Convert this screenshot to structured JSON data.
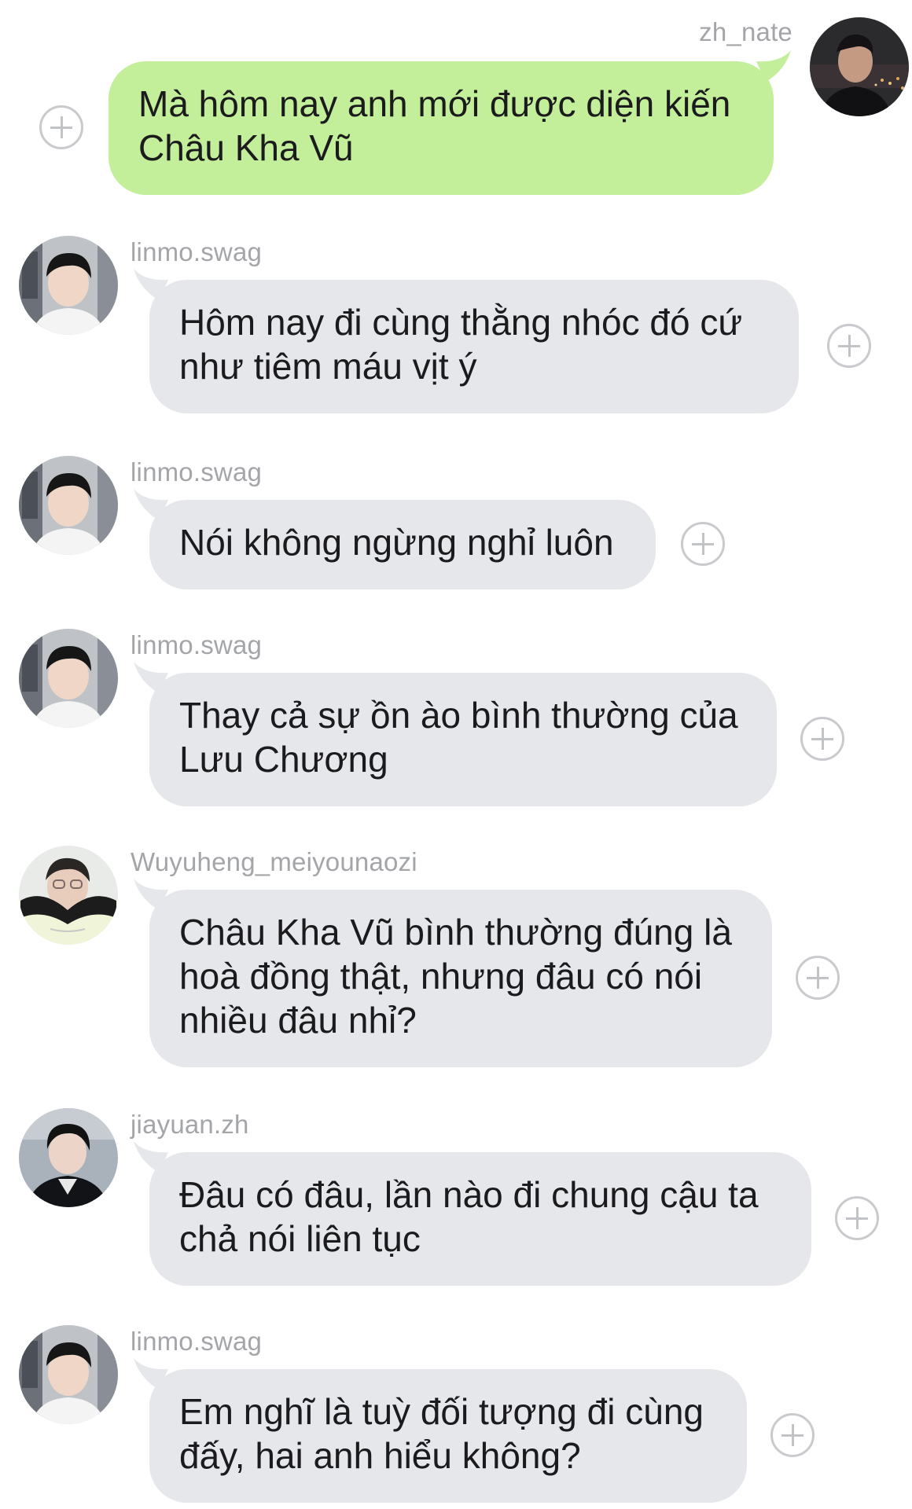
{
  "messages": [
    {
      "username": "zh_nate",
      "direction": "outgoing",
      "avatar": "zh-nate-avatar",
      "lines": [
        "Mà hôm nay anh mới được diện kiến",
        "Châu Kha Vũ"
      ]
    },
    {
      "username": "linmo.swag",
      "direction": "incoming",
      "avatar": "linmo-avatar",
      "lines": [
        "Hôm nay đi cùng thằng nhóc đó cứ",
        "như tiêm máu vịt ý"
      ]
    },
    {
      "username": "linmo.swag",
      "direction": "incoming",
      "avatar": "linmo-avatar",
      "lines": [
        "Nói không ngừng nghỉ luôn"
      ]
    },
    {
      "username": "linmo.swag",
      "direction": "incoming",
      "avatar": "linmo-avatar",
      "lines": [
        "Thay cả sự ồn ào bình thường của",
        "Lưu Chương"
      ]
    },
    {
      "username": "Wuyuheng_meiyounaozi",
      "direction": "incoming",
      "avatar": "wuyuheng-avatar",
      "lines": [
        "Châu Kha Vũ bình thường đúng là",
        "hoà đồng thật, nhưng đâu có nói",
        "nhiều đâu nhỉ?"
      ]
    },
    {
      "username": "jiayuan.zh",
      "direction": "incoming",
      "avatar": "jiayuan-avatar",
      "lines": [
        "Đâu có đâu, lần nào đi chung cậu ta",
        "chả nói liên tục"
      ]
    },
    {
      "username": "linmo.swag",
      "direction": "incoming",
      "avatar": "linmo-avatar",
      "lines": [
        "Em nghĩ là tuỳ đối tượng đi cùng",
        "đấy, hai anh hiểu không?"
      ]
    }
  ],
  "colors": {
    "outgoing_bubble": "#c3ee9a",
    "incoming_bubble": "#e6e7ea",
    "username": "#a3a5a9",
    "text": "#1b1b1d",
    "plus_icon": "#c9cacd"
  },
  "icons": {
    "add_reaction": "plus-circle-icon"
  }
}
